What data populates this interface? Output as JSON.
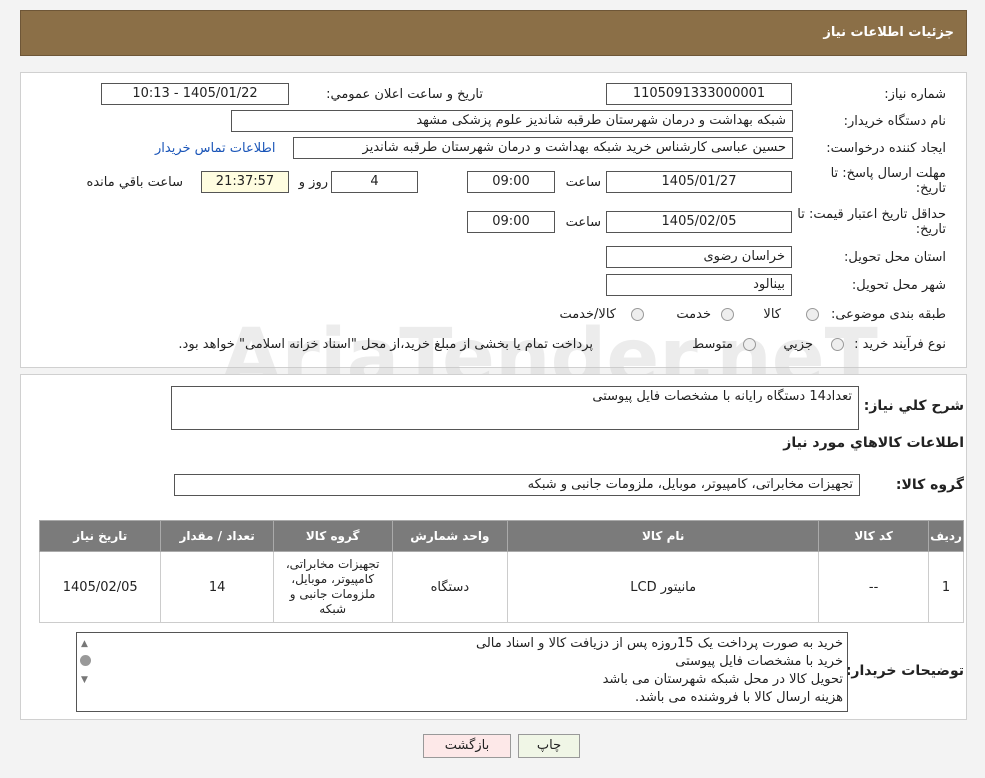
{
  "header": {
    "title": "جزئیات اطلاعات نیاز"
  },
  "fields": {
    "need_number_label": "شماره نیاز:",
    "need_number": "1105091333000001",
    "announce_label": "تاریخ و ساعت اعلان عمومي:",
    "announce_value": "1405/01/22 - 10:13",
    "buyer_label": "نام دستگاه خریدار:",
    "buyer_value": "شبکه بهداشت و درمان شهرستان طرقبه شاندیز   علوم پزشکی مشهد",
    "creator_label": "ایجاد کننده درخواست:",
    "creator_value": "حسین عباسی کارشناس خرید شبکه بهداشت و درمان شهرستان طرقبه شاندیز",
    "contact_link": "اطلاعات تماس خریدار",
    "deadline_label": "مهلت ارسال پاسخ: تا تاریخ:",
    "deadline_date": "1405/01/27",
    "time_label": "ساعت",
    "deadline_time": "09:00",
    "days_value": "4",
    "days_label": "روز و",
    "remaining_time": "21:37:57",
    "remaining_label": "ساعت باقي مانده",
    "validity_label": "حداقل تاریخ اعتبار قیمت: تا تاریخ:",
    "validity_date": "1405/02/05",
    "validity_time": "09:00",
    "province_label": "استان محل تحویل:",
    "province_value": "خراسان رضوی",
    "city_label": "شهر محل تحویل:",
    "city_value": "بینالود",
    "category_label": "طبقه بندی موضوعی:",
    "cat_opt1": "کالا",
    "cat_opt2": "خدمت",
    "cat_opt3": "کالا/خدمت",
    "process_label": "نوع فرآیند خرید :",
    "proc_opt1": "جزیي",
    "proc_opt2": "متوسط",
    "process_note": "پرداخت تمام یا بخشی از مبلغ خرید،از محل \"اسناد خزانه اسلامی\" خواهد بود."
  },
  "desc": {
    "label": "شرح کلي نیاز:",
    "value": "تعداد14 دستگاه رایانه با مشخصات فایل پیوستی"
  },
  "items_title": "اطلاعات کالاهاي مورد نياز",
  "group": {
    "label": "گروه کالا:",
    "value": "تجهیزات مخابراتی، کامپیوتر، موبایل، ملزومات جانبی و شبکه"
  },
  "table": {
    "headers": [
      "ردیف",
      "کد کالا",
      "نام کالا",
      "واحد شمارش",
      "گروه کالا",
      "تعداد / مقدار",
      "تاریخ نیاز"
    ],
    "row": [
      "1",
      "--",
      "مانیتور LCD",
      "دستگاه",
      "تجهیزات مخابراتی، کامپیوتر، موبایل، ملزومات جانبی و شبکه",
      "14",
      "1405/02/05"
    ]
  },
  "notes": {
    "label": "توضیحات خریدار:",
    "lines": [
      "خرید به صورت پرداخت یک 15روزه پس از دزیافت کالا و اسناد مالی",
      "خرید با مشخصات فایل پیوستی",
      "تحویل کالا در محل شبکه شهرستان می باشد",
      "هزینه ارسال کالا با فروشنده می باشد."
    ]
  },
  "buttons": {
    "print": "چاپ",
    "back": "بازگشت"
  },
  "watermark": "AriaTender.neT"
}
